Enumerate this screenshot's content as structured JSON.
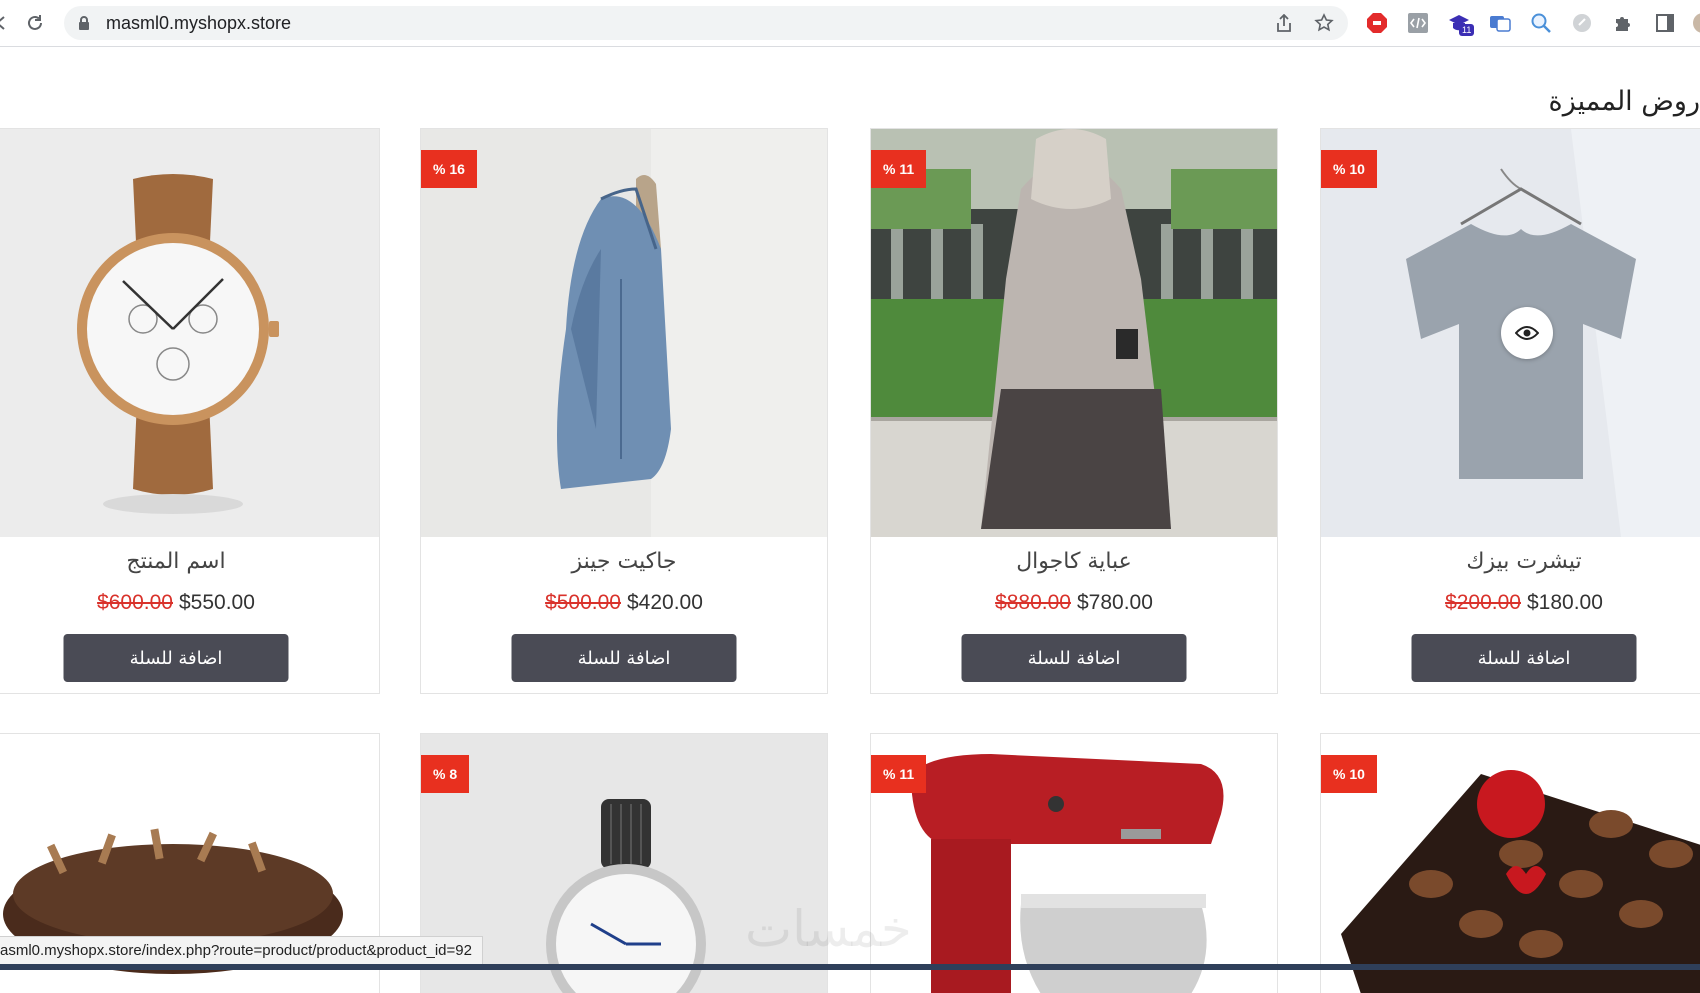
{
  "browser": {
    "url": "masml0.myshopx.store",
    "extension_badge": "11"
  },
  "section": {
    "title": "روض المميزة"
  },
  "products": [
    {
      "name": "اسم المنتج",
      "old_price": "$600.00",
      "price": "$550.00",
      "discount": "%",
      "add_label": "اضافة للسلة"
    },
    {
      "name": "جاكيت جينز",
      "old_price": "$500.00",
      "price": "$420.00",
      "discount": "% 16",
      "add_label": "اضافة للسلة"
    },
    {
      "name": "عباية كاجوال",
      "old_price": "$880.00",
      "price": "$780.00",
      "discount": "% 11",
      "add_label": "اضافة للسلة"
    },
    {
      "name": "تيشرت بيزك",
      "old_price": "$200.00",
      "price": "$180.00",
      "discount": "% 10",
      "add_label": "اضافة للسلة"
    }
  ],
  "row2_badges": [
    "%",
    "% 8",
    "% 11",
    "% 10"
  ],
  "status_url": "asml0.myshopx.store/index.php?route=product/product&product_id=92",
  "watermark": "خمسات",
  "colors": {
    "badge": "#e8301f",
    "button": "#4a4b55",
    "old_price": "#d9322b"
  },
  "icons": [
    "reload-icon",
    "lock-icon",
    "share-icon",
    "star-icon",
    "eye-icon",
    "puzzle-icon",
    "sidebar-icon"
  ]
}
